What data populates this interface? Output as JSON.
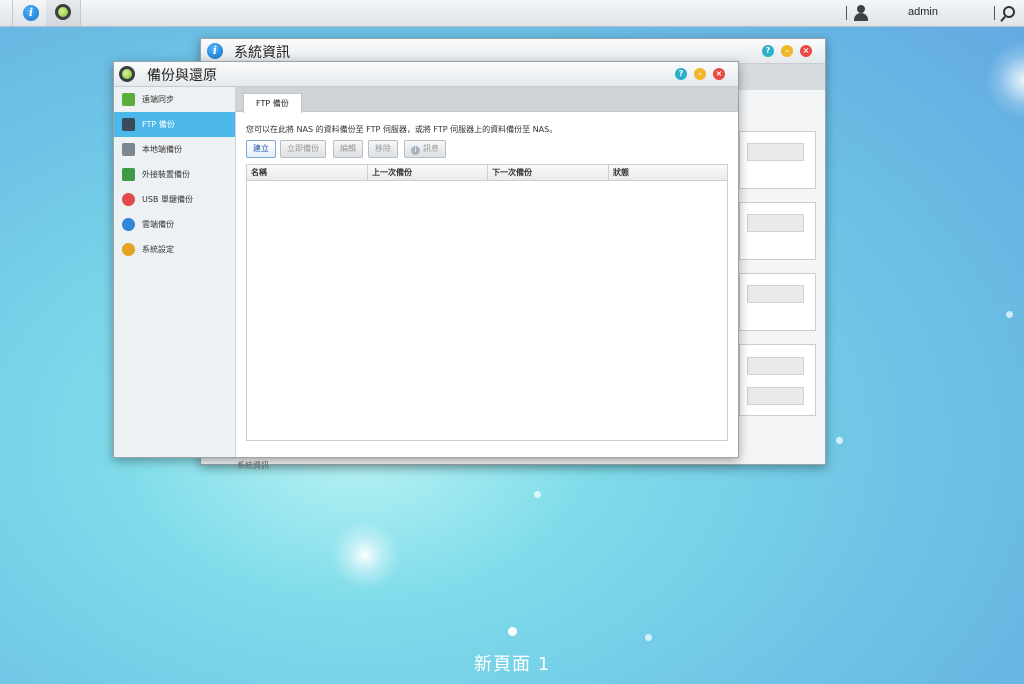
{
  "topbar": {
    "username": "admin"
  },
  "windows": {
    "sysinfo": {
      "title": "系統資訊",
      "footer": "系統資訊"
    },
    "backup": {
      "title": "備份與還原",
      "sidebar": [
        {
          "label": "遠端同步",
          "icon": "sync-icon"
        },
        {
          "label": "FTP 備份",
          "icon": "ftp-server-icon",
          "active": true
        },
        {
          "label": "本地端備份",
          "icon": "local-drive-icon"
        },
        {
          "label": "外接裝置備份",
          "icon": "external-device-icon"
        },
        {
          "label": "USB 單鍵備份",
          "icon": "usb-button-icon"
        },
        {
          "label": "雲端備份",
          "icon": "cloud-icon"
        },
        {
          "label": "系統設定",
          "icon": "gear-icon"
        }
      ],
      "tab": "FTP 備份",
      "description": "您可以在此將 NAS 的資料備份至 FTP 伺服器，或將 FTP 伺服器上的資料備份至 NAS。",
      "buttons": {
        "create": "建立",
        "backup_now": "立即備份",
        "edit": "編輯",
        "remove": "移除",
        "info": "訊息"
      },
      "columns": [
        "名稱",
        "上一次備份",
        "下一次備份",
        "狀態"
      ]
    }
  },
  "desktop": {
    "page_label": "新頁面 1"
  },
  "colors": {
    "accent": "#4cb8ea",
    "close": "#ea4a44",
    "minimize": "#f1b52a",
    "help": "#2cb0c9"
  }
}
